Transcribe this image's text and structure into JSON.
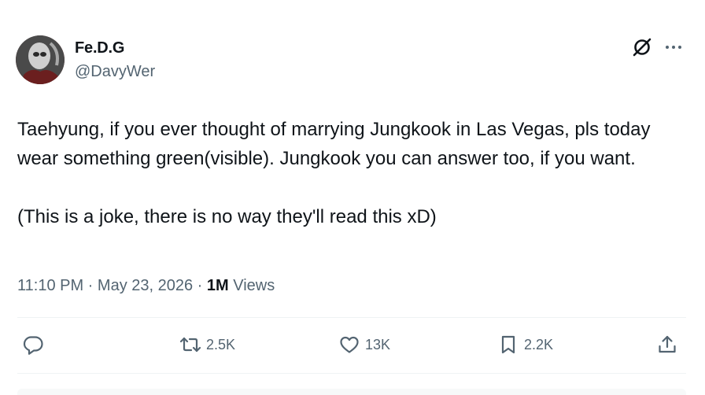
{
  "author": {
    "name": "Fe.D.G",
    "handle": "@DavyWer"
  },
  "tweet": {
    "text": "Taehyung, if you ever thought of marrying Jungkook in Las Vegas, pls today wear something green(visible). Jungkook you can answer too, if you want.\n\n(This is a joke, there is no way they'll read this xD)"
  },
  "meta": {
    "time": "11:10 PM",
    "separator": " · ",
    "date": "May 23, 2026",
    "views_count": "1M",
    "views_label": " Views"
  },
  "actions": {
    "reply_icon": "reply-icon",
    "retweet_count": "2.5K",
    "like_count": "13K",
    "bookmark_count": "2.2K",
    "share_icon": "share-icon"
  },
  "colors": {
    "text": "#0f1419",
    "secondary": "#536471",
    "divider": "#eff3f4"
  }
}
